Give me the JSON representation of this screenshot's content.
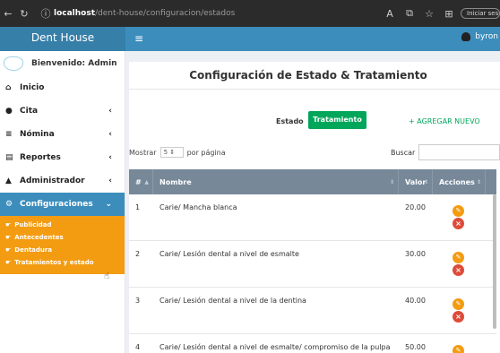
{
  "browser": {
    "url_host": "localhost",
    "url_path": "/dent-house/configuracion/estados",
    "signin_label": "Iniciar sesión"
  },
  "header": {
    "brand": "Dent House",
    "user_name": "byron"
  },
  "sidebar": {
    "welcome": "Bienvenido: Admin",
    "items": [
      {
        "label": "Inicio",
        "icon": "home-icon"
      },
      {
        "label": "Cita",
        "icon": "clock-icon"
      },
      {
        "label": "Nómina",
        "icon": "list-icon"
      },
      {
        "label": "Reportes",
        "icon": "file-icon"
      },
      {
        "label": "Administrador",
        "icon": "lock-icon"
      },
      {
        "label": "Configuraciones",
        "icon": "cogs-icon"
      }
    ],
    "submenu": [
      {
        "label": "Publicidad"
      },
      {
        "label": "Antecedentes"
      },
      {
        "label": "Dentadura"
      },
      {
        "label": "Tratamientos y estado"
      }
    ]
  },
  "main": {
    "title": "Configuración de Estado & Tratamiento",
    "tab_estado": "Estado",
    "tab_tratamiento": "Tratamiento",
    "add_new": "AGREGAR NUEVO",
    "mostrar": "Mostrar",
    "page_size": "5",
    "por_pagina": "por página",
    "buscar": "Buscar",
    "columns": [
      "#",
      "Nombre",
      "Valor",
      "Acciones"
    ],
    "rows": [
      {
        "num": "1",
        "nombre": "Carie/ Mancha blanca",
        "valor": "20.00"
      },
      {
        "num": "2",
        "nombre": "Carie/ Lesión dental a nivel de esmalte",
        "valor": "30.00"
      },
      {
        "num": "3",
        "nombre": "Carie/ Lesión dental a nivel de la dentina",
        "valor": "40.00"
      },
      {
        "num": "4",
        "nombre": "Carie/ Lesión dental a nivel de esmalte/ compromiso de la pulpa",
        "valor": "50.00"
      }
    ]
  },
  "colors": {
    "navbar": "#3c8dbc",
    "submenu": "#f39c12",
    "success": "#00a65a",
    "table_header": "#778899",
    "danger": "#dd4b39"
  }
}
